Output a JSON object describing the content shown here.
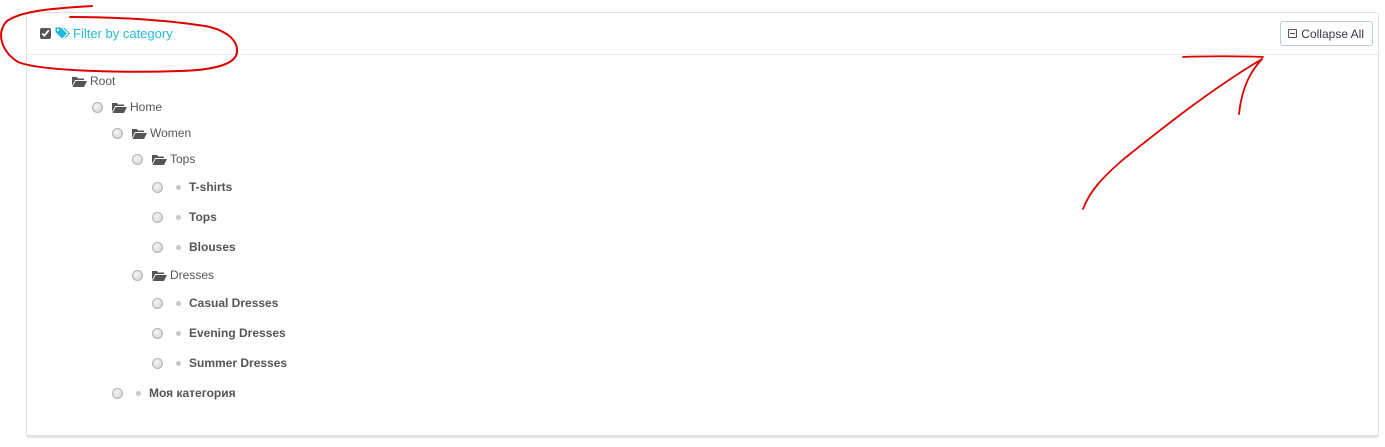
{
  "filter": {
    "label": "Filter by category",
    "checked": true,
    "accent_color": "#25b9d7"
  },
  "toolbar": {
    "collapse_label": "Collapse All"
  },
  "tree": {
    "root": "Root",
    "home": "Home",
    "women": "Women",
    "tops_folder": "Tops",
    "tops_children": [
      "T-shirts",
      "Tops",
      "Blouses"
    ],
    "dresses": "Dresses",
    "dresses_children": [
      "Casual Dresses",
      "Evening Dresses",
      "Summer Dresses"
    ],
    "custom": "Моя категория"
  },
  "annotation_color": "#dd0000"
}
